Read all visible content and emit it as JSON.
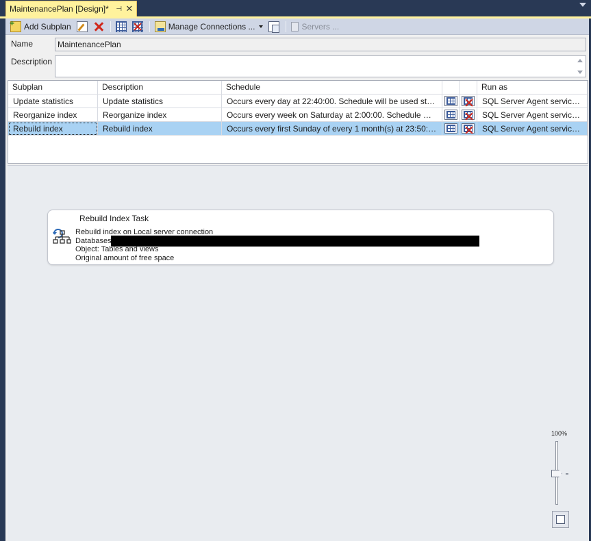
{
  "tab": {
    "title": "MaintenancePlan [Design]*",
    "pin": "⊣",
    "close": "✕"
  },
  "toolbar": {
    "add_subplan": "Add Subplan",
    "manage_connections": "Manage Connections ...",
    "servers": "Servers ..."
  },
  "form": {
    "name_label": "Name",
    "name_value": "MaintenancePlan",
    "description_label": "Description",
    "description_value": ""
  },
  "grid": {
    "headers": [
      "Subplan",
      "Description",
      "Schedule",
      "",
      "",
      "Run as"
    ],
    "rows": [
      {
        "subplan": "Update statistics",
        "description": "Update statistics",
        "schedule": "Occurs every day at 22:40:00. Schedule will be used starting...",
        "run_as": "SQL Server Agent service ...",
        "selected": false
      },
      {
        "subplan": "Reorganize index",
        "description": "Reorganize index",
        "schedule": "Occurs every week on Saturday at 2:00:00. Schedule will be ...",
        "run_as": "SQL Server Agent service ...",
        "selected": false
      },
      {
        "subplan": "Rebuild index",
        "description": "Rebuild index",
        "schedule": "Occurs every first Sunday of every 1 month(s) at 23:50:00. ...",
        "run_as": "SQL Server Agent service ...",
        "selected": true
      }
    ]
  },
  "task": {
    "title": "Rebuild Index Task",
    "lines": [
      "Rebuild index on Local server connection",
      "Databases:",
      "Object: Tables and views",
      "Original amount of free space"
    ]
  },
  "zoom": {
    "label": "100%",
    "level_percent": 100
  },
  "colors": {
    "tab_active": "#fff29d",
    "chrome": "#293955",
    "toolbar": "#cfd6e5",
    "selection": "#a9d2f3"
  }
}
